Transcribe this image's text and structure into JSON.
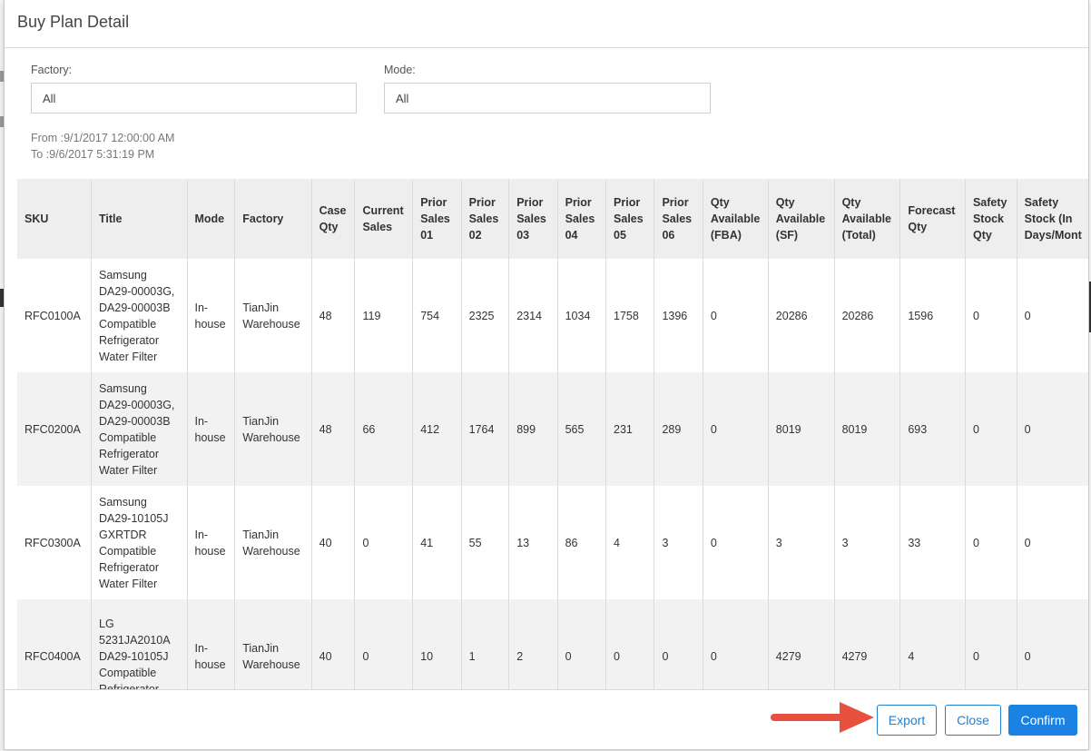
{
  "modal": {
    "title": "Buy Plan Detail"
  },
  "filters": {
    "factory": {
      "label": "Factory:",
      "value": "All"
    },
    "mode": {
      "label": "Mode:",
      "value": "All"
    }
  },
  "date_range": {
    "from": "From :9/1/2017 12:00:00 AM",
    "to": "To :9/6/2017 5:31:19 PM"
  },
  "table": {
    "columns": [
      [
        "SKU"
      ],
      [
        "Title"
      ],
      [
        "Mode"
      ],
      [
        "Factory"
      ],
      [
        "Case",
        "Qty"
      ],
      [
        "Current",
        "Sales"
      ],
      [
        "Prior",
        "Sales",
        "01"
      ],
      [
        "Prior",
        "Sales",
        "02"
      ],
      [
        "Prior",
        "Sales",
        "03"
      ],
      [
        "Prior",
        "Sales",
        "04"
      ],
      [
        "Prior",
        "Sales",
        "05"
      ],
      [
        "Prior",
        "Sales",
        "06"
      ],
      [
        "Qty",
        "Available",
        "(FBA)"
      ],
      [
        "Qty",
        "Available",
        "(SF)"
      ],
      [
        "Qty",
        "Available",
        "(Total)"
      ],
      [
        "Forecast",
        "Qty"
      ],
      [
        "Safety",
        "Stock",
        "Qty"
      ],
      [
        "Safety",
        "Stock (In",
        "Days/Mont"
      ]
    ],
    "rows": [
      {
        "sku": "RFC0100A",
        "title": [
          "Samsung",
          "DA29-00003G,",
          "DA29-00003B",
          "Compatible",
          "Refrigerator",
          "Water Filter"
        ],
        "mode": [
          "In-",
          "house"
        ],
        "factory": [
          "TianJin",
          "Warehouse"
        ],
        "values": [
          "48",
          "119",
          "754",
          "2325",
          "2314",
          "1034",
          "1758",
          "1396",
          "0",
          "20286",
          "20286",
          "1596",
          "0",
          "0"
        ]
      },
      {
        "sku": "RFC0200A",
        "title": [
          "Samsung",
          "DA29-00003G,",
          "DA29-00003B",
          "Compatible",
          "Refrigerator",
          "Water Filter"
        ],
        "mode": [
          "In-",
          "house"
        ],
        "factory": [
          "TianJin",
          "Warehouse"
        ],
        "values": [
          "48",
          "66",
          "412",
          "1764",
          "899",
          "565",
          "231",
          "289",
          "0",
          "8019",
          "8019",
          "693",
          "0",
          "0"
        ]
      },
      {
        "sku": "RFC0300A",
        "title": [
          "Samsung",
          "DA29-10105J",
          "GXRTDR",
          "Compatible",
          "Refrigerator",
          "Water Filter"
        ],
        "mode": [
          "In-",
          "house"
        ],
        "factory": [
          "TianJin",
          "Warehouse"
        ],
        "values": [
          "40",
          "0",
          "41",
          "55",
          "13",
          "86",
          "4",
          "3",
          "0",
          "3",
          "3",
          "33",
          "0",
          "0"
        ]
      },
      {
        "sku": "RFC0400A",
        "title": [
          "LG",
          "5231JA2010A",
          "DA29-10105J",
          "Compatible",
          "Refrigerator"
        ],
        "mode": [
          "In-",
          "house"
        ],
        "factory": [
          "TianJin",
          "Warehouse"
        ],
        "values": [
          "40",
          "0",
          "10",
          "1",
          "2",
          "0",
          "0",
          "0",
          "0",
          "4279",
          "4279",
          "4",
          "0",
          "0"
        ]
      }
    ]
  },
  "footer": {
    "export_label": "Export",
    "close_label": "Close",
    "confirm_label": "Confirm"
  },
  "colors": {
    "primary": "#1a82e2",
    "arrow": "#e8503e",
    "header_bg": "#eeeeef"
  },
  "icons": {
    "annotation": "red-arrow-icon"
  }
}
